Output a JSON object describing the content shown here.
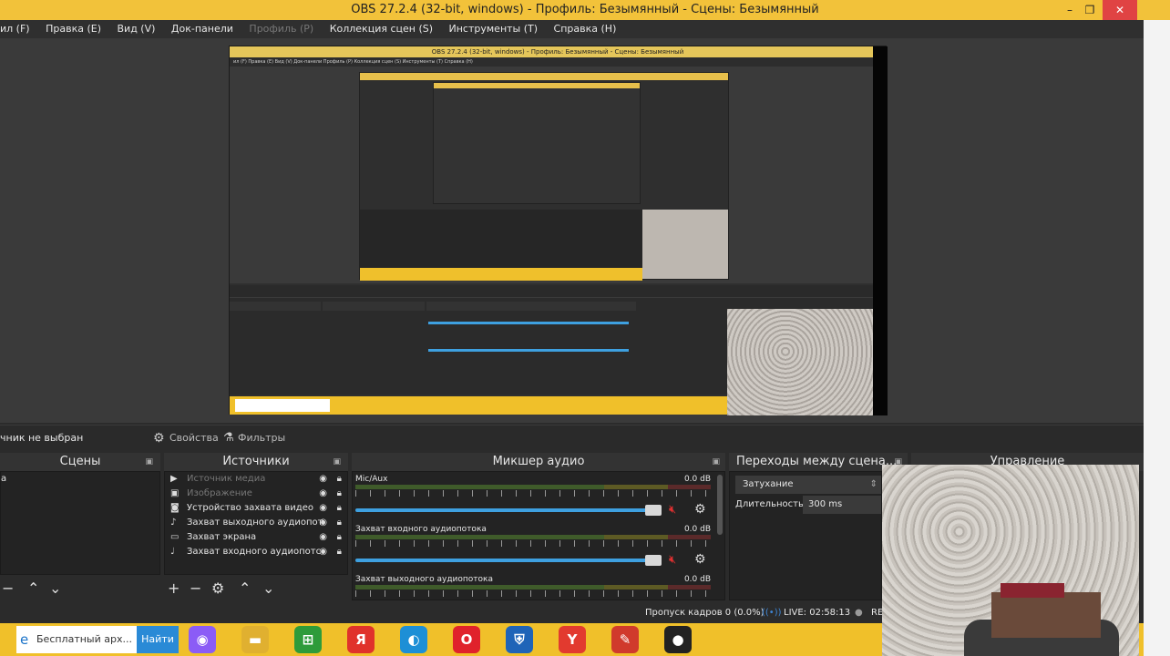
{
  "window": {
    "title": "OBS 27.2.4 (32-bit, windows) - Профиль: Безымянный - Сцены: Безымянный",
    "btn_minimize": "–",
    "btn_restore": "❐",
    "btn_close": "✕"
  },
  "menu": [
    "ил (F)",
    "Правка (E)",
    "Вид (V)",
    "Док-панели",
    "Профиль (P)",
    "Коллекция сцен (S)",
    "Инструменты (T)",
    "Справка (H)"
  ],
  "nested_preview": {
    "title": "OBS 27.2.4 (32-bit, windows) - Профиль: Безымянный - Сцены: Безымянный",
    "menu": "ил (F)  Правка (E)  Вид (V)  Док-панели  Профиль (P)  Коллекция сцен (S)  Инструменты (T)  Справка (H)"
  },
  "toolbar": {
    "no_source": "чник не выбран",
    "properties": "Свойства",
    "filters": "Фильтры"
  },
  "panels": {
    "scenes_title": "Сцены",
    "scene_item": "а",
    "sources_title": "Источники",
    "mixer_title": "Микшер аудио",
    "transitions_title": "Переходы между сцена...",
    "controls_title": "Управление"
  },
  "sources": [
    {
      "label": "Источник медиа",
      "icon": "▶",
      "dim": true
    },
    {
      "label": "Изображение",
      "icon": "▣",
      "dim": true
    },
    {
      "label": "Устройство захвата видео",
      "icon": "◙",
      "dim": false
    },
    {
      "label": "Захват выходного аудиопот",
      "icon": "♪",
      "dim": false
    },
    {
      "label": "Захват экрана",
      "icon": "▭",
      "dim": false
    },
    {
      "label": "Захват входного аудиопотс",
      "icon": "♩",
      "dim": false
    }
  ],
  "mixer": [
    {
      "name": "Mic/Aux",
      "db": "0.0 dB"
    },
    {
      "name": "Захват входного аудиопотока",
      "db": "0.0 dB"
    },
    {
      "name": "Захват выходного аудиопотока",
      "db": "0.0 dB"
    }
  ],
  "mixer_ticks": [
    "-60",
    "-55",
    "-50",
    "-45",
    "-40",
    "-35",
    "-30",
    "-25",
    "-20",
    "-15",
    "-10",
    "-5",
    "0"
  ],
  "transitions": {
    "type": "Затухание",
    "duration_label": "Длительность",
    "duration_value": "300 ms"
  },
  "status": {
    "dropped": "Пропуск кадров 0 (0.0%)",
    "live": "LIVE: 02:58:13",
    "rec": "RE"
  },
  "taskbar": {
    "search_text": "Бесплатный арх...",
    "find_button": "Найти",
    "apps": [
      {
        "icon": "alice-icon",
        "glyph": "◉",
        "color": "#8b5cf6"
      },
      {
        "icon": "explorer-icon",
        "glyph": "▬",
        "color": "#e0b030"
      },
      {
        "icon": "store-icon",
        "glyph": "⊞",
        "color": "#2e9b3a"
      },
      {
        "icon": "yandex-icon",
        "glyph": "Я",
        "color": "#e0322b"
      },
      {
        "icon": "edge-icon",
        "glyph": "◐",
        "color": "#1d8fd6"
      },
      {
        "icon": "opera-icon",
        "glyph": "O",
        "color": "#e0222b"
      },
      {
        "icon": "shield-icon",
        "glyph": "⛨",
        "color": "#1f64b8"
      },
      {
        "icon": "yandex-browser-icon",
        "glyph": "Y",
        "color": "#e23a2f"
      },
      {
        "icon": "notepad-icon",
        "glyph": "✎",
        "color": "#d03a2c"
      },
      {
        "icon": "obs-icon",
        "glyph": "●",
        "color": "#222222"
      }
    ]
  }
}
